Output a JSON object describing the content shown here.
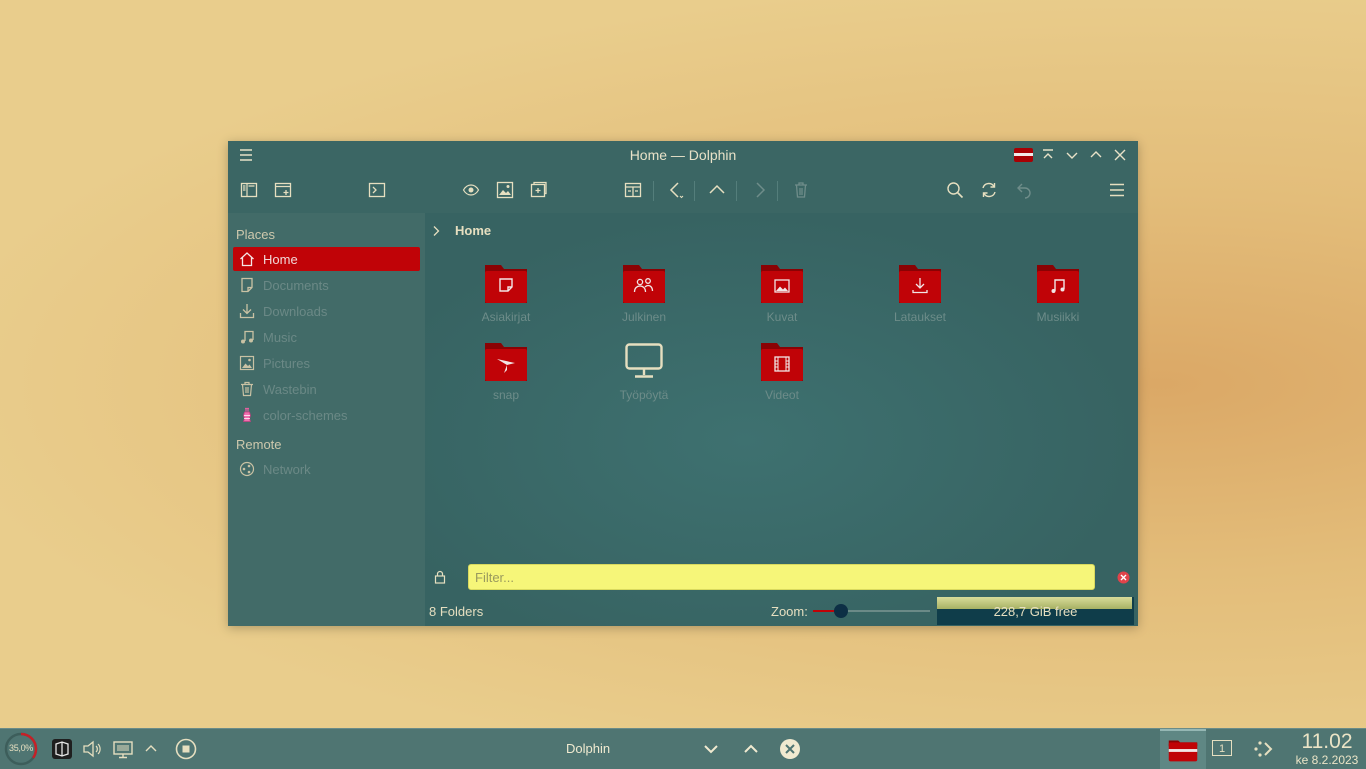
{
  "window": {
    "title": "Home — Dolphin"
  },
  "sidebar": {
    "sections": [
      {
        "title": "Places",
        "items": [
          {
            "label": "Home",
            "icon": "home-icon",
            "active": true
          },
          {
            "label": "Documents",
            "icon": "documents-icon"
          },
          {
            "label": "Downloads",
            "icon": "downloads-icon"
          },
          {
            "label": "Music",
            "icon": "music-icon"
          },
          {
            "label": "Pictures",
            "icon": "pictures-icon"
          },
          {
            "label": "Wastebin",
            "icon": "wastebin-icon"
          },
          {
            "label": "color-schemes",
            "icon": "color-schemes-icon"
          }
        ]
      },
      {
        "title": "Remote",
        "items": [
          {
            "label": "Network",
            "icon": "network-icon"
          }
        ]
      }
    ]
  },
  "breadcrumb": {
    "current": "Home"
  },
  "folders": [
    {
      "label": "Asiakirjat",
      "icon": "folder-documents-icon"
    },
    {
      "label": "Julkinen",
      "icon": "folder-public-icon"
    },
    {
      "label": "Kuvat",
      "icon": "folder-pictures-icon"
    },
    {
      "label": "Lataukset",
      "icon": "folder-downloads-icon"
    },
    {
      "label": "Musiikki",
      "icon": "folder-music-icon"
    },
    {
      "label": "snap",
      "icon": "folder-snap-icon"
    },
    {
      "label": "Työpöytä",
      "icon": "desktop-icon"
    },
    {
      "label": "Videot",
      "icon": "folder-videos-icon"
    }
  ],
  "filter": {
    "placeholder": "Filter..."
  },
  "status": {
    "text": "8 Folders",
    "zoom_label": "Zoom:",
    "zoom_level": 0.24,
    "free_space": "228,7 GiB free",
    "used_fraction": 0.99
  },
  "taskbar": {
    "cpu_load": "35,0%",
    "cpu_fraction": 0.35,
    "task_title": "Dolphin",
    "pager": "1",
    "time": "11.02",
    "date": "ke 8.2.2023"
  },
  "colors": {
    "accent": "#c00307",
    "window_bg": "#3b6664",
    "filter_bg": "#f6f679",
    "text": "#e6dfc0"
  }
}
